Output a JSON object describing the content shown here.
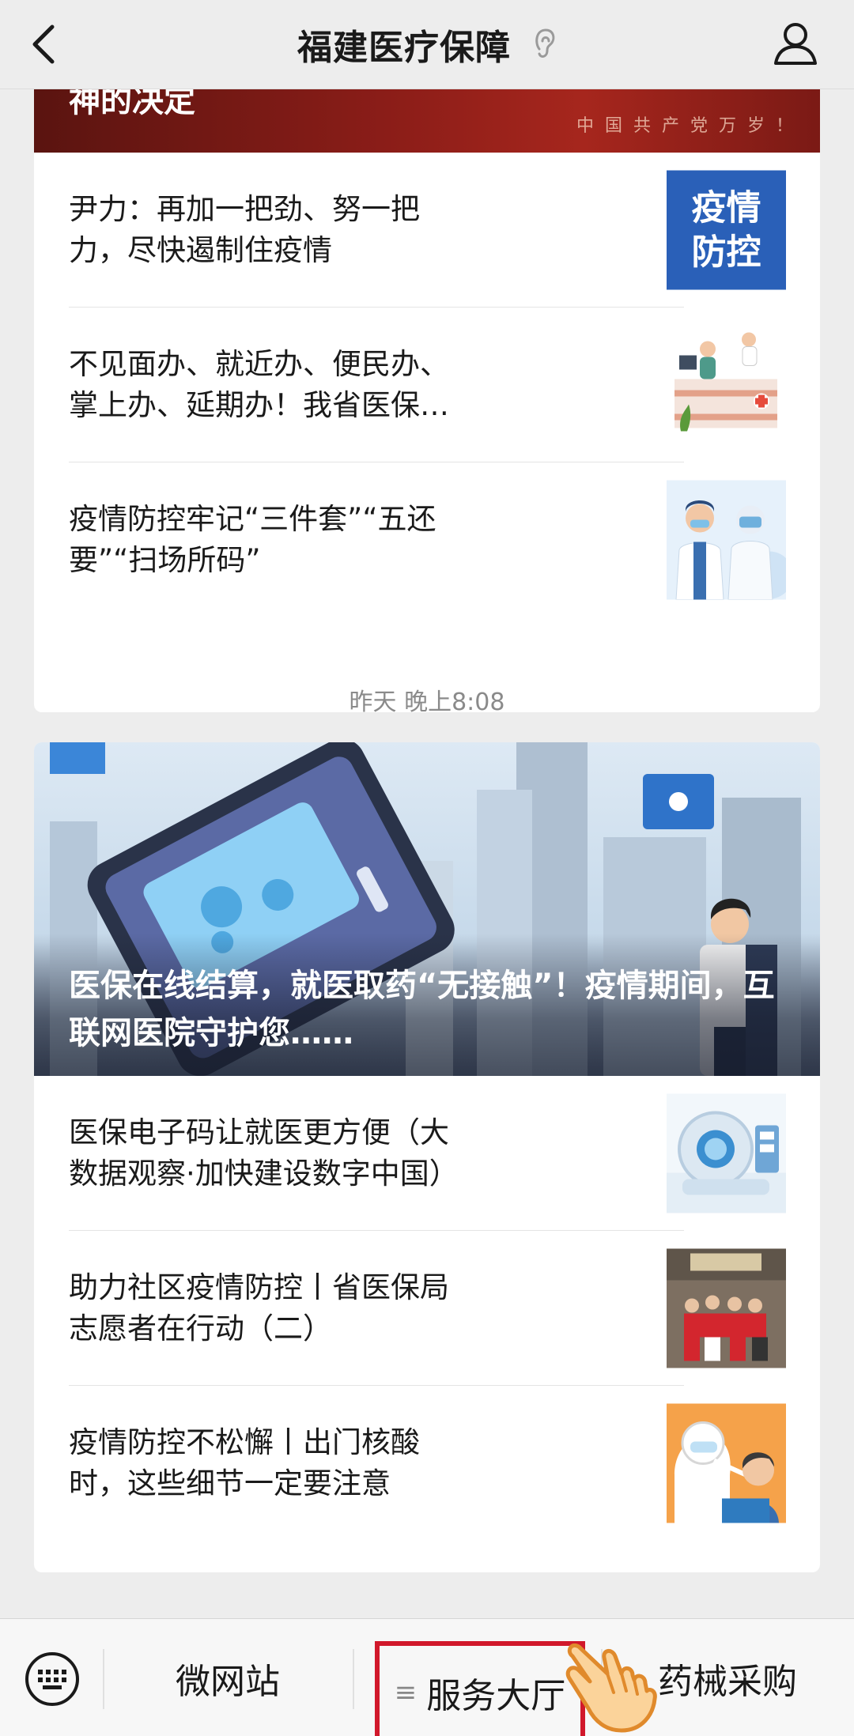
{
  "header": {
    "title": "福建医疗保障",
    "back_icon": "chevron-left-icon",
    "ear_icon": "ear-icon",
    "profile_icon": "person-icon"
  },
  "card1": {
    "cover_text": "神的决定",
    "cover_banner": "中国共产党万岁！",
    "items": [
      {
        "title": "尹力：再加一把劲、努一把力，尽快遏制住疫情",
        "thumb_text_1": "疫情",
        "thumb_text_2": "防控"
      },
      {
        "title": "不见面办、就近办、便民办、掌上办、延期办！我省医保经办机构全力做…"
      },
      {
        "title": "疫情防控牢记“三件套”“五还要”“扫场所码”"
      }
    ]
  },
  "timestamp": "昨天 晚上8:08",
  "card2": {
    "cover_title": "医保在线结算，就医取药“无接触”！疫情期间，互联网医院守护您……",
    "items": [
      {
        "title": "医保电子码让就医更方便（大数据观察·加快建设数字中国）"
      },
      {
        "title": "助力社区疫情防控丨省医保局志愿者在行动（二）"
      },
      {
        "title": "疫情防控不松懈丨出门核酸时，这些细节一定要注意"
      }
    ]
  },
  "bottom_menu": {
    "keyboard_icon": "keyboard-icon",
    "items": [
      {
        "label": "微网站"
      },
      {
        "label": "服务大厅",
        "glyph": "≡"
      },
      {
        "label": "药械采购"
      }
    ],
    "pointer_icon": "hand-pointer-icon"
  },
  "colors": {
    "highlight": "#d1182b",
    "background": "#ededed"
  }
}
